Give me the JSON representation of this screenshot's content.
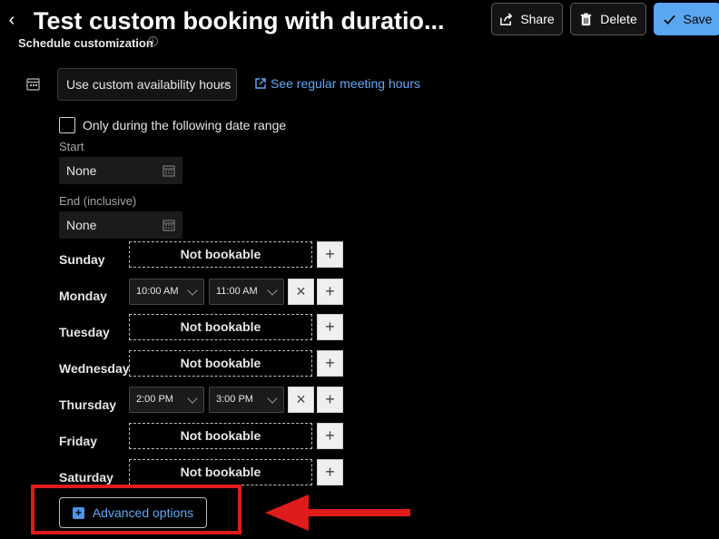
{
  "header": {
    "back_glyph": "‹",
    "title": "Test custom booking with duratio...",
    "share_label": "Share",
    "delete_label": "Delete",
    "save_label": "Save"
  },
  "schedule": {
    "section_title": "Schedule customization",
    "availability_select": "Use custom availability hours",
    "regular_hours_link": "See regular meeting hours",
    "date_range_checkbox_label": "Only during the following date range",
    "date_range_checked": false,
    "start_label": "Start",
    "start_value": "None",
    "end_label": "End (inclusive)",
    "end_value": "None"
  },
  "days": [
    {
      "name": "Sunday",
      "status": "Not bookable"
    },
    {
      "name": "Monday",
      "start": "10:00 AM",
      "end": "11:00 AM"
    },
    {
      "name": "Tuesday",
      "status": "Not bookable"
    },
    {
      "name": "Wednesday",
      "status": "Not bookable"
    },
    {
      "name": "Thursday",
      "start": "2:00 PM",
      "end": "3:00 PM"
    },
    {
      "name": "Friday",
      "status": "Not bookable"
    },
    {
      "name": "Saturday",
      "status": "Not bookable"
    }
  ],
  "controls": {
    "add_glyph": "+",
    "remove_glyph": "×"
  },
  "advanced": {
    "label": "Advanced options",
    "plus_glyph": "+"
  },
  "colors": {
    "accent": "#5ba6f0",
    "link": "#62a8f5",
    "annotation": "#e01b1b",
    "background": "#000000"
  },
  "icons": {
    "back": "chevron-left-icon",
    "share": "share-icon",
    "delete": "trash-icon",
    "save": "checkmark-icon",
    "calendar": "calendar-icon",
    "external_link": "external-link-icon"
  }
}
